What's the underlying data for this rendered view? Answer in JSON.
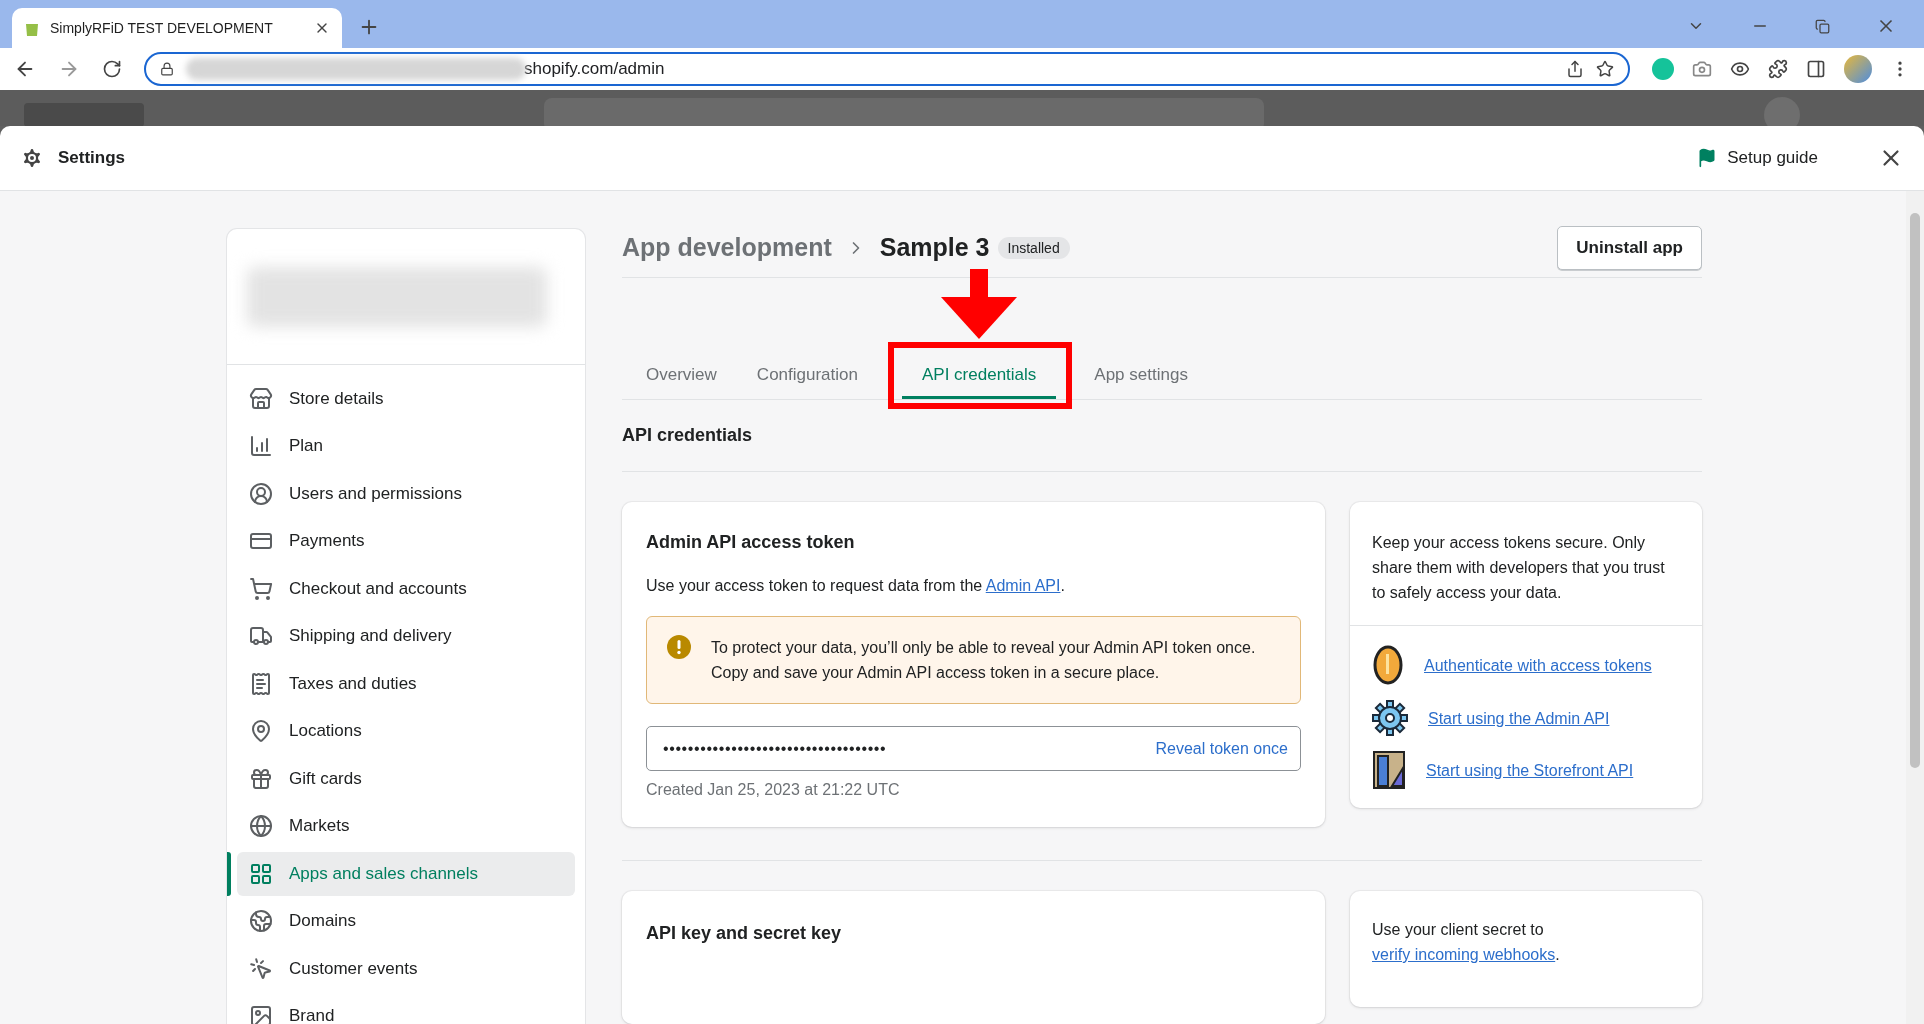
{
  "browser": {
    "tab_title": "SimplyRFiD TEST DEVELOPMENT",
    "url": "shopify.com/admin"
  },
  "settings": {
    "title": "Settings",
    "setup_guide": "Setup guide"
  },
  "sidebar": {
    "items": [
      {
        "label": "Store details",
        "selected": false
      },
      {
        "label": "Plan",
        "selected": false
      },
      {
        "label": "Users and permissions",
        "selected": false
      },
      {
        "label": "Payments",
        "selected": false
      },
      {
        "label": "Checkout and accounts",
        "selected": false
      },
      {
        "label": "Shipping and delivery",
        "selected": false
      },
      {
        "label": "Taxes and duties",
        "selected": false
      },
      {
        "label": "Locations",
        "selected": false
      },
      {
        "label": "Gift cards",
        "selected": false
      },
      {
        "label": "Markets",
        "selected": false
      },
      {
        "label": "Apps and sales channels",
        "selected": true
      },
      {
        "label": "Domains",
        "selected": false
      },
      {
        "label": "Customer events",
        "selected": false
      },
      {
        "label": "Brand",
        "selected": false
      }
    ]
  },
  "breadcrumb": {
    "parent": "App development",
    "current": "Sample 3",
    "badge": "Installed"
  },
  "uninstall_button": "Uninstall app",
  "tabs": [
    {
      "label": "Overview",
      "selected": false,
      "annotated": false
    },
    {
      "label": "Configuration",
      "selected": false,
      "annotated": false
    },
    {
      "label": "API credentials",
      "selected": true,
      "annotated": true
    },
    {
      "label": "App settings",
      "selected": false,
      "annotated": false
    }
  ],
  "section_title": "API credentials",
  "token_card": {
    "title": "Admin API access token",
    "description": {
      "before": "Use your access token to request data from the ",
      "link": "Admin API",
      "after": "."
    },
    "warning": "To protect your data, you’ll only be able to reveal your Admin API token once. Copy and save your Admin API access token in a secure place.",
    "token": "••••••••••••••••••••••••••••••••••••",
    "reveal_link": "Reveal token once",
    "created": "Created Jan 25, 2023 at 21:22 UTC"
  },
  "help_card": {
    "text": "Keep your access tokens secure. Only share them with developers that you trust to safely access your data.",
    "links": [
      "Authenticate with access tokens",
      "Start using the Admin API",
      "Start using the Storefront API"
    ]
  },
  "key_card": {
    "title": "API key and secret key"
  },
  "webhook_card": {
    "before": "Use your client secret to ",
    "link": "verify incoming webhooks",
    "after": "."
  }
}
